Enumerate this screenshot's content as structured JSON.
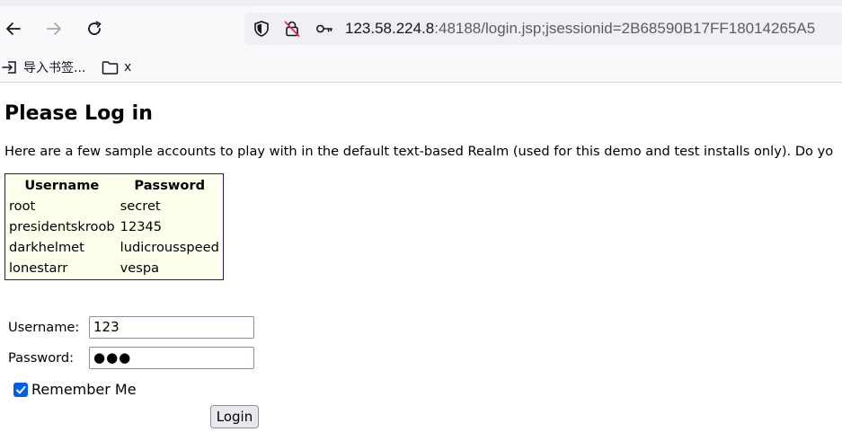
{
  "browser": {
    "url_host": "123.58.224.8",
    "url_rest": ":48188/login.jsp;jsessionid=2B68590B17FF18014265A5",
    "bookmarks": [
      {
        "label": "导入书签...",
        "icon": "import-icon"
      },
      {
        "label": "x",
        "icon": "folder-icon"
      }
    ]
  },
  "page": {
    "title": "Please Log in",
    "intro": "Here are a few sample accounts to play with in the default text-based Realm (used for this demo and test installs only). Do yo",
    "table": {
      "headers": [
        "Username",
        "Password"
      ],
      "rows": [
        [
          "root",
          "secret"
        ],
        [
          "presidentskroob",
          "12345"
        ],
        [
          "darkhelmet",
          "ludicrousspeed"
        ],
        [
          "lonestarr",
          "vespa"
        ]
      ]
    },
    "form": {
      "username_label": "Username:",
      "username_value": "123",
      "password_label": "Password:",
      "password_masked": "●●●",
      "remember_label": "Remember Me",
      "remember_checked": true,
      "login_label": "Login"
    }
  }
}
